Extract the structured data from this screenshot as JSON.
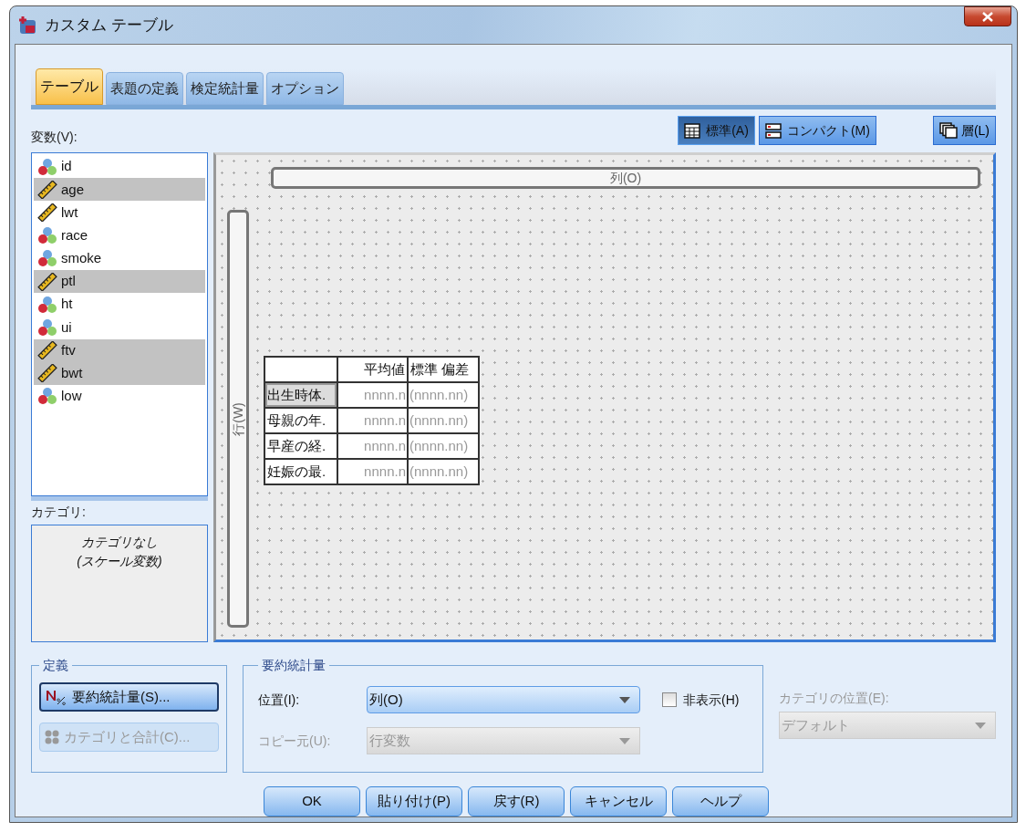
{
  "window": {
    "title": "カスタム テーブル"
  },
  "tabs": [
    {
      "label": "テーブル",
      "selected": true
    },
    {
      "label": "表題の定義",
      "selected": false
    },
    {
      "label": "検定統計量",
      "selected": false
    },
    {
      "label": "オプション",
      "selected": false
    }
  ],
  "variables_label": "変数(V):",
  "view_buttons": [
    {
      "label": "標準(A)",
      "kind": "grid",
      "selected": true
    },
    {
      "label": "コンパクト(M)",
      "kind": "compact",
      "selected": false
    }
  ],
  "layers_button": {
    "label": "層(L)"
  },
  "variables": [
    {
      "name": "id",
      "kind": "nominal",
      "selected": false
    },
    {
      "name": "age",
      "kind": "scale",
      "selected": true
    },
    {
      "name": "lwt",
      "kind": "scale",
      "selected": false
    },
    {
      "name": "race",
      "kind": "nominal",
      "selected": false
    },
    {
      "name": "smoke",
      "kind": "nominal",
      "selected": false
    },
    {
      "name": "ptl",
      "kind": "scale",
      "selected": true
    },
    {
      "name": "ht",
      "kind": "nominal",
      "selected": false
    },
    {
      "name": "ui",
      "kind": "nominal",
      "selected": false
    },
    {
      "name": "ftv",
      "kind": "scale",
      "selected": true
    },
    {
      "name": "bwt",
      "kind": "scale",
      "selected": true
    },
    {
      "name": "low",
      "kind": "nominal",
      "selected": false
    }
  ],
  "categories": {
    "label": "カテゴリ:",
    "text": "カテゴリなし (スケール変数)"
  },
  "canvas": {
    "columns_zone": "列(O)",
    "rows_zone": "行(W)",
    "table": {
      "columns": [
        "",
        "平均値",
        "標準 偏差"
      ],
      "rows": [
        {
          "selected": true,
          "cells": [
            "出生時体.",
            "nnnn.n",
            "(nnnn.nn)"
          ]
        },
        {
          "selected": false,
          "cells": [
            "母親の年.",
            "nnnn.n",
            "(nnnn.nn)"
          ]
        },
        {
          "selected": false,
          "cells": [
            "早産の経.",
            "nnnn.n",
            "(nnnn.nn)"
          ]
        },
        {
          "selected": false,
          "cells": [
            "妊娠の最.",
            "nnnn.n",
            "(nnnn.nn)"
          ]
        }
      ]
    }
  },
  "define_group": {
    "title": "定義",
    "buttons": [
      {
        "label": "要約統計量(S)...",
        "kind": "summary",
        "disabled": false
      },
      {
        "label": "カテゴリと合計(C)...",
        "kind": "categories",
        "disabled": true
      }
    ]
  },
  "summary_group": {
    "title": "要約統計量",
    "position_label": "位置(I):",
    "position_value": "列(O)",
    "hide": {
      "label": "非表示(H)",
      "checked": false
    },
    "copy_label": "コピー元(U):",
    "copy_value": "行変数"
  },
  "category_position": {
    "label": "カテゴリの位置(E):",
    "value": "デフォルト"
  },
  "buttons": [
    "OK",
    "貼り付け(P)",
    "戻す(R)",
    "キャンセル",
    "ヘルプ"
  ]
}
